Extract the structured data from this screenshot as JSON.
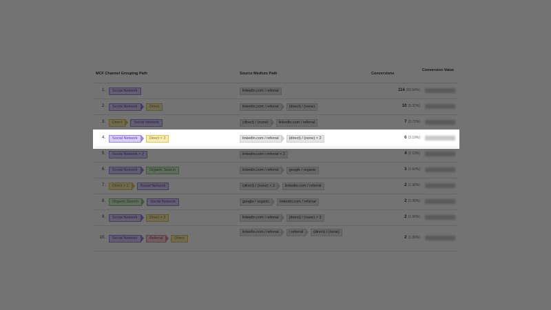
{
  "headers": {
    "mcf": "MCF Channel Grouping Path",
    "smp": "Source Medium Path",
    "conversions": "Conversions",
    "conversion_value": "Conversion Value"
  },
  "colors": {
    "social": {
      "bg": "#d9cff5",
      "border": "#9a86d8",
      "text": "#5a43b0"
    },
    "direct": {
      "bg": "#f7ecb5",
      "border": "#d7c46a",
      "text": "#8a7a20"
    },
    "organic": {
      "bg": "#d6efd1",
      "border": "#8dc383",
      "text": "#3f7f36"
    },
    "referral": {
      "bg": "#f5d3dc",
      "border": "#d88ea2",
      "text": "#a2405a"
    }
  },
  "rows": [
    {
      "n": "1.",
      "mcf": [
        {
          "t": "Social Network",
          "c": "social"
        }
      ],
      "smp": [
        "linkedin.com / referral"
      ],
      "conv": "114",
      "pct": "(60.64%)"
    },
    {
      "n": "2.",
      "mcf": [
        {
          "t": "Social Network",
          "c": "social"
        },
        {
          "t": "Direct",
          "c": "direct"
        }
      ],
      "smp": [
        "linkedin.com / referral",
        "(direct) / (none)"
      ],
      "conv": "10",
      "pct": "(5.32%)"
    },
    {
      "n": "3.",
      "mcf": [
        {
          "t": "Direct",
          "c": "direct"
        },
        {
          "t": "Social Network",
          "c": "social"
        }
      ],
      "smp": [
        "(direct) / (none)",
        "linkedin.com / referral"
      ],
      "conv": "7",
      "pct": "(3.72%)"
    },
    {
      "n": "4.",
      "mcf": [
        {
          "t": "Social Network",
          "c": "social"
        },
        {
          "t": "Direct × 2",
          "c": "direct"
        }
      ],
      "smp": [
        "linkedin.com / referral",
        "(direct) / (none) × 2"
      ],
      "conv": "6",
      "pct": "(3.19%)"
    },
    {
      "n": "5.",
      "mcf": [
        {
          "t": "Social Network × 2",
          "c": "social"
        }
      ],
      "smp": [
        "linkedin.com / referral × 2"
      ],
      "conv": "4",
      "pct": "(2.13%)"
    },
    {
      "n": "6.",
      "mcf": [
        {
          "t": "Social Network",
          "c": "social"
        },
        {
          "t": "Organic Search",
          "c": "organic"
        }
      ],
      "smp": [
        "linkedin.com / referral",
        "google / organic"
      ],
      "conv": "3",
      "pct": "(1.60%)"
    },
    {
      "n": "7.",
      "mcf": [
        {
          "t": "Direct × 2",
          "c": "direct"
        },
        {
          "t": "Social Network",
          "c": "social"
        }
      ],
      "smp": [
        "(direct) / (none) × 2",
        "linkedin.com / referral"
      ],
      "conv": "2",
      "pct": "(1.06%)"
    },
    {
      "n": "8.",
      "mcf": [
        {
          "t": "Organic Search",
          "c": "organic"
        },
        {
          "t": "Social Network",
          "c": "social"
        }
      ],
      "smp": [
        "google / organic",
        "linkedin.com / referral"
      ],
      "conv": "2",
      "pct": "(1.06%)"
    },
    {
      "n": "9.",
      "mcf": [
        {
          "t": "Social Network",
          "c": "social"
        },
        {
          "t": "Direct × 2",
          "c": "direct"
        }
      ],
      "smp": [
        "linkedin.com / referral",
        "(direct) / (none) × 3"
      ],
      "conv": "2",
      "pct": "(1.06%)"
    },
    {
      "n": "10.",
      "mcf": [
        {
          "t": "Social Network",
          "c": "social"
        },
        {
          "t": "Referral",
          "c": "referral"
        },
        {
          "t": "Direct",
          "c": "direct"
        }
      ],
      "smp": [
        "linkedin.com / referral",
        "/ referral",
        "(direct) / (none)"
      ],
      "conv": "2",
      "pct": "(1.06%)"
    }
  ]
}
